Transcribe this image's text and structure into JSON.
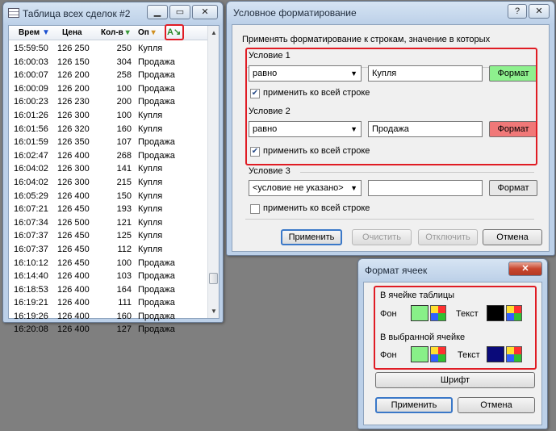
{
  "deals_window": {
    "title": "Таблица всех сделок #2",
    "columns": [
      "Врем",
      "Цена",
      "Кол-в",
      "Оп"
    ],
    "rows": [
      [
        "15:59:50",
        "126 250",
        "250",
        "Купля"
      ],
      [
        "16:00:03",
        "126 150",
        "304",
        "Продажа"
      ],
      [
        "16:00:07",
        "126 200",
        "258",
        "Продажа"
      ],
      [
        "16:00:09",
        "126 200",
        "100",
        "Продажа"
      ],
      [
        "16:00:23",
        "126 230",
        "200",
        "Продажа"
      ],
      [
        "16:01:26",
        "126 300",
        "100",
        "Купля"
      ],
      [
        "16:01:56",
        "126 320",
        "160",
        "Купля"
      ],
      [
        "16:01:59",
        "126 350",
        "107",
        "Продажа"
      ],
      [
        "16:02:47",
        "126 400",
        "268",
        "Продажа"
      ],
      [
        "16:04:02",
        "126 300",
        "141",
        "Купля"
      ],
      [
        "16:04:02",
        "126 300",
        "215",
        "Купля"
      ],
      [
        "16:05:29",
        "126 400",
        "150",
        "Купля"
      ],
      [
        "16:07:21",
        "126 450",
        "193",
        "Купля"
      ],
      [
        "16:07:34",
        "126 500",
        "121",
        "Купля"
      ],
      [
        "16:07:37",
        "126 450",
        "125",
        "Купля"
      ],
      [
        "16:07:37",
        "126 450",
        "112",
        "Купля"
      ],
      [
        "16:10:12",
        "126 450",
        "100",
        "Продажа"
      ],
      [
        "16:14:40",
        "126 400",
        "103",
        "Продажа"
      ],
      [
        "16:18:53",
        "126 400",
        "164",
        "Продажа"
      ],
      [
        "16:19:21",
        "126 400",
        "111",
        "Продажа"
      ],
      [
        "16:19:26",
        "126 400",
        "160",
        "Продажа"
      ],
      [
        "16:20:08",
        "126 400",
        "127",
        "Продажа"
      ]
    ],
    "scroll_fraction": 0.95
  },
  "cf_dialog": {
    "title": "Условное форматирование",
    "intro": "Применять форматирование к строкам, значение в которых",
    "conditions": [
      {
        "label": "Условие 1",
        "operator": "равно",
        "value": "Купля",
        "format_label": "Формат",
        "format_color": "#8ef08e",
        "apply_row_label": "применить ко всей строке",
        "apply_row": true
      },
      {
        "label": "Условие 2",
        "operator": "равно",
        "value": "Продажа",
        "format_label": "Формат",
        "format_color": "#f07878",
        "apply_row_label": "применить ко всей строке",
        "apply_row": true
      },
      {
        "label": "Условие 3",
        "operator": "<условие не указано>",
        "value": "",
        "format_label": "Формат",
        "format_color": "#e8e8e8",
        "apply_row_label": "применить ко всей строке",
        "apply_row": false
      }
    ],
    "buttons": {
      "apply": "Применить",
      "clear": "Очистить",
      "disable": "Отключить",
      "cancel": "Отмена"
    }
  },
  "fmt_dialog": {
    "title": "Формат ячеек",
    "table_cell_label": "В ячейке таблицы",
    "selected_cell_label": "В выбранной ячейке",
    "bg_label": "Фон",
    "text_label": "Текст",
    "table_bg_color": "#88f088",
    "table_text_color": "#000000",
    "selected_bg_color": "#88f088",
    "selected_text_color": "#0a0a7a",
    "font_button": "Шрифт",
    "apply_button": "Применить",
    "cancel_button": "Отмена"
  }
}
